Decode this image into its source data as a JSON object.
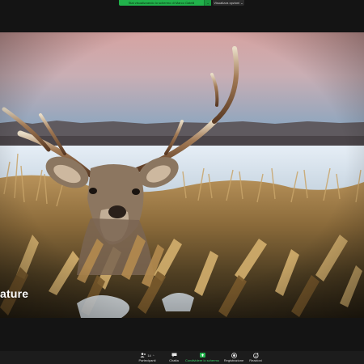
{
  "top_bar": {
    "share_banner_text": "Stai visualizzando lo schermo di Marco Gatelli",
    "share_banner_caret": "⌄",
    "view_options_label": "Visualizza opzioni ⌄",
    "accent_color": "#21b24b"
  },
  "shared_screen": {
    "caption": "ature",
    "scene": "deer with large antlers lying in dry winter grass"
  },
  "toolbar": {
    "participants": {
      "label": "Partecipanti",
      "count": "14",
      "icon": "people-icon"
    },
    "chat": {
      "label": "Chatta",
      "icon": "chat-icon"
    },
    "share": {
      "label": "Condividere lo schermo",
      "icon": "share-screen-icon"
    },
    "record": {
      "label": "Registrazione",
      "icon": "record-icon"
    },
    "reactions": {
      "label": "Reazioni",
      "icon": "reaction-icon"
    }
  }
}
